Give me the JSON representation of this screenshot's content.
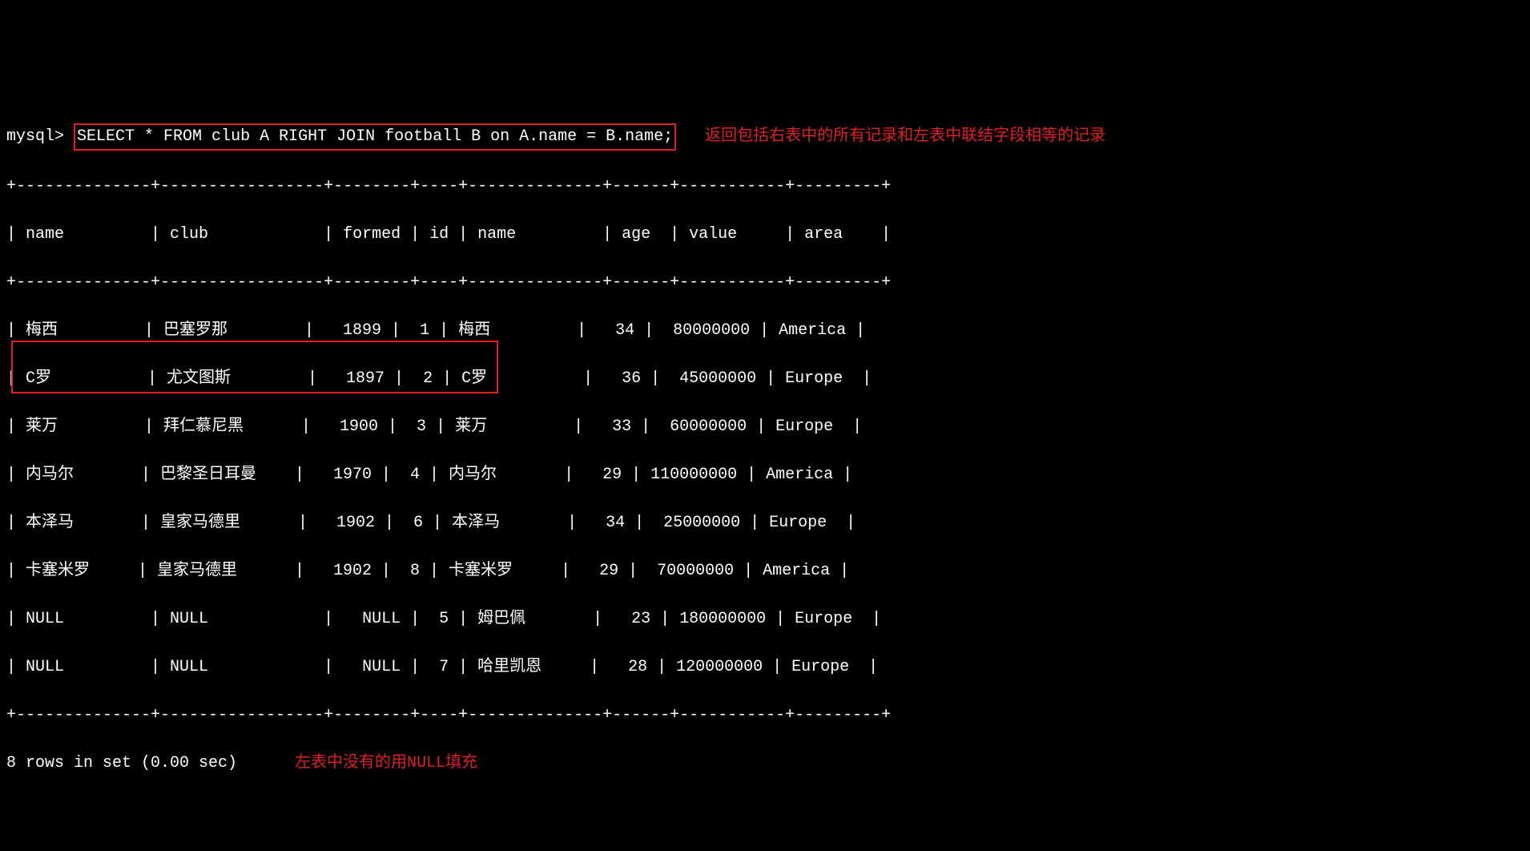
{
  "prompt": "mysql>",
  "sql": "SELECT * FROM club A RIGHT JOIN football B on A.name = B.name;",
  "annotation_top": "返回包括右表中的所有记录和左表中联结字段相等的记录",
  "annotation_bottom": "左表中没有的用NULL填充",
  "border_top": "+--------------+-----------------+--------+----+--------------+------+-----------+---------+",
  "header_line": "| name         | club            | formed | id | name         | age  | value     | area    |",
  "rows": [
    "| 梅西         | 巴塞罗那        |   1899 |  1 | 梅西         |   34 |  80000000 | America |",
    "| C罗          | 尤文图斯        |   1897 |  2 | C罗          |   36 |  45000000 | Europe  |",
    "| 莱万         | 拜仁慕尼黑      |   1900 |  3 | 莱万         |   33 |  60000000 | Europe  |",
    "| 内马尔       | 巴黎圣日耳曼    |   1970 |  4 | 内马尔       |   29 | 110000000 | America |",
    "| 本泽马       | 皇家马德里      |   1902 |  6 | 本泽马       |   34 |  25000000 | Europe  |",
    "| 卡塞米罗     | 皇家马德里      |   1902 |  8 | 卡塞米罗     |   29 |  70000000 | America |",
    "| NULL         | NULL            |   NULL |  5 | 姆巴佩       |   23 | 180000000 | Europe  |",
    "| NULL         | NULL            |   NULL |  7 | 哈里凯恩     |   28 | 120000000 | Europe  |"
  ],
  "footer": "8 rows in set (0.00 sec)",
  "chart_data": {
    "type": "table",
    "columns": [
      "name",
      "club",
      "formed",
      "id",
      "name",
      "age",
      "value",
      "area"
    ],
    "rows": [
      [
        "梅西",
        "巴塞罗那",
        1899,
        1,
        "梅西",
        34,
        80000000,
        "America"
      ],
      [
        "C罗",
        "尤文图斯",
        1897,
        2,
        "C罗",
        36,
        45000000,
        "Europe"
      ],
      [
        "莱万",
        "拜仁慕尼黑",
        1900,
        3,
        "莱万",
        33,
        60000000,
        "Europe"
      ],
      [
        "内马尔",
        "巴黎圣日耳曼",
        1970,
        4,
        "内马尔",
        29,
        110000000,
        "America"
      ],
      [
        "本泽马",
        "皇家马德里",
        1902,
        6,
        "本泽马",
        34,
        25000000,
        "Europe"
      ],
      [
        "卡塞米罗",
        "皇家马德里",
        1902,
        8,
        "卡塞米罗",
        29,
        70000000,
        "America"
      ],
      [
        null,
        null,
        null,
        5,
        "姆巴佩",
        23,
        180000000,
        "Europe"
      ],
      [
        null,
        null,
        null,
        7,
        "哈里凯恩",
        28,
        120000000,
        "Europe"
      ]
    ]
  }
}
